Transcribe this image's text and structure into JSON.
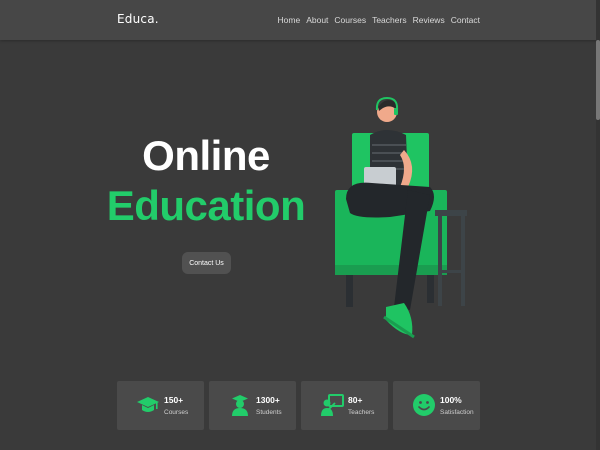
{
  "brand": {
    "logo": "Educa."
  },
  "nav": {
    "items": [
      "Home",
      "About",
      "Courses",
      "Teachers",
      "Reviews",
      "Contact"
    ]
  },
  "hero": {
    "title_line1": "Online",
    "title_line2": "Education",
    "cta_label": "Contact Us"
  },
  "stats": [
    {
      "value": "150+",
      "label": "Courses",
      "icon": "graduation-cap-icon"
    },
    {
      "value": "1300+",
      "label": "Students",
      "icon": "student-icon"
    },
    {
      "value": "80+",
      "label": "Teachers",
      "icon": "teacher-icon"
    },
    {
      "value": "100%",
      "label": "Satisfaction",
      "icon": "smiley-icon"
    }
  ],
  "colors": {
    "accent": "#22cc6a",
    "background": "#3a3a3a",
    "navbar": "#474747",
    "card": "#4a4a4a"
  }
}
